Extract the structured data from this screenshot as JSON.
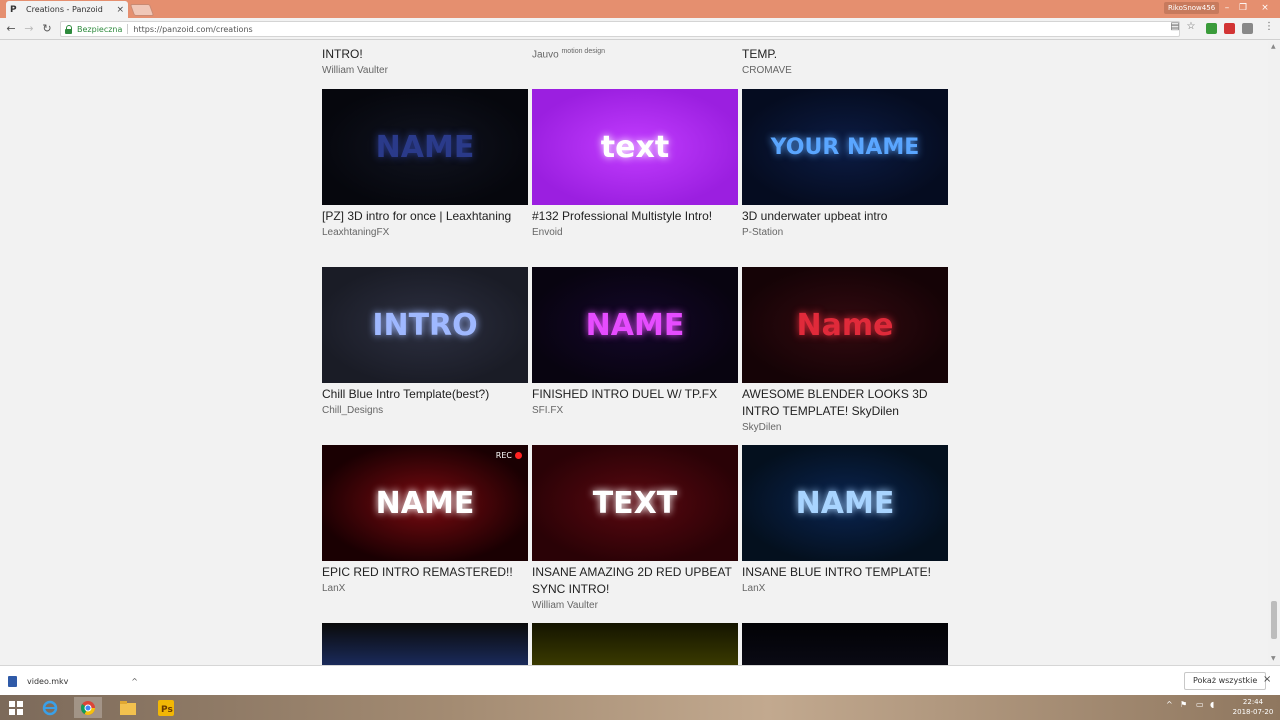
{
  "browser": {
    "tab_title": "Creations - Panzoid",
    "tab_favicon": "P",
    "tab_close": "×",
    "profile_name": "RikoSnow456",
    "window_controls": [
      "–",
      "❐",
      "×"
    ],
    "secure_label": "Bezpieczna",
    "url": "https://panzoid.com/creations"
  },
  "partial_top_row": [
    {
      "title": "INTRO!",
      "author": "William Vaulter"
    },
    {
      "title": "",
      "author": "Jauvo",
      "author_suffix": "motion design"
    },
    {
      "title": "TEMP.",
      "author": "CROMAVE"
    }
  ],
  "cards": [
    {
      "title": "[PZ] 3D intro for once | Leaxhtaning",
      "author": "LeaxhtaningFX",
      "thumb_text": "NAME",
      "thumb_colors": [
        "#06070d",
        "#10131f"
      ],
      "text_color": "#2a3a8a"
    },
    {
      "title": "#132 Professional Multistyle Intro!",
      "author": "Envoid",
      "thumb_text": "text",
      "thumb_colors": [
        "#9b1fe0",
        "#c23cff"
      ],
      "text_color": "#ffffff"
    },
    {
      "title": "3D underwater upbeat intro",
      "author": "P-Station",
      "thumb_text": "YOUR NAME",
      "thumb_colors": [
        "#050c20",
        "#0c1c44"
      ],
      "text_color": "#5aa6ff"
    },
    {
      "title": "Chill Blue Intro Template(best?)",
      "author": "Chill_Designs",
      "thumb_text": "INTRO",
      "thumb_colors": [
        "#1a1c26",
        "#2c2f40"
      ],
      "text_color": "#9fb8ff"
    },
    {
      "title": "FINISHED INTRO DUEL W/ TP.FX",
      "author": "SFI.FX",
      "thumb_text": "NAME",
      "thumb_colors": [
        "#080410",
        "#14072a"
      ],
      "text_color": "#e64cff"
    },
    {
      "title": "AWESOME BLENDER LOOKS 3D INTRO TEMPLATE! SkyDilen",
      "author": "SkyDilen",
      "thumb_text": "Name",
      "thumb_colors": [
        "#150306",
        "#330a10"
      ],
      "text_color": "#e02a3a"
    },
    {
      "title": "EPIC RED INTRO REMASTERED!!",
      "author": "LanX",
      "thumb_text": "NAME",
      "thumb_colors": [
        "#1a0002",
        "#7a0a10"
      ],
      "text_color": "#ffffff",
      "overlay": "REC"
    },
    {
      "title": "INSANE AMAZING 2D RED UPBEAT SYNC INTRO!",
      "author": "William Vaulter",
      "thumb_text": "TEXT",
      "thumb_colors": [
        "#2a0206",
        "#5a0810"
      ],
      "text_color": "#ffffff"
    },
    {
      "title": "INSANE BLUE INTRO TEMPLATE!",
      "author": "LanX",
      "thumb_text": "NAME",
      "thumb_colors": [
        "#04101e",
        "#0a2450"
      ],
      "text_color": "#a8d4ff"
    }
  ],
  "bottom_thumbs": [
    {
      "thumb_colors": [
        "#0a0a0a",
        "#1a2a5a"
      ]
    },
    {
      "thumb_colors": [
        "#141400",
        "#3a3a00"
      ]
    },
    {
      "thumb_colors": [
        "#020205",
        "#0a0a14"
      ]
    }
  ],
  "download": {
    "file_name": "video.mkv",
    "show_all_label": "Pokaż wszystkie",
    "close": "×"
  },
  "taskbar": {
    "time": "22:44",
    "date": "2018-07-20"
  },
  "colors": {
    "titlebar": "#e58f6f",
    "secure_green": "#2e8b3d",
    "page_bg": "#f2f2f2"
  }
}
